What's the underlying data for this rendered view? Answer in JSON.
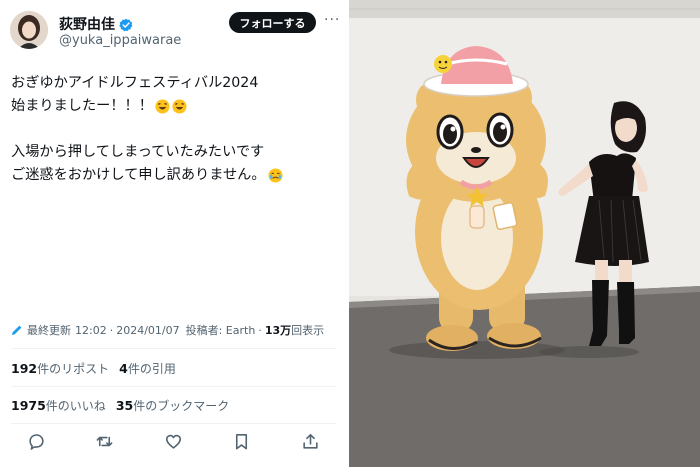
{
  "tweet": {
    "display_name": "荻野由佳",
    "handle": "@yuka_ippaiwarae",
    "verified": true,
    "follow_label": "フォローする",
    "more_label": "···",
    "lines": [
      "おぎゆかアイドルフェスティバル2024",
      "始まりましたー！！！",
      "",
      "入場から押してしまっていたみたいです",
      "ご迷惑をおかけして申し訳ありません。"
    ],
    "meta": {
      "edited_label": "最終更新",
      "time": "12:02",
      "sep1": "·",
      "date": "2024/01/07",
      "posted_label": "投稿者: Earth",
      "sep2": "·",
      "views": "13万",
      "views_label": "回表示"
    },
    "stats": {
      "reposts_count": "192",
      "reposts_label": "件のリポスト",
      "quotes_count": "4",
      "quotes_label": "件の引用",
      "likes_count": "1975",
      "likes_label": "件のいいね",
      "bookmarks_count": "35",
      "bookmarks_label": "件のブックマーク"
    },
    "actions": [
      "reply-icon",
      "repost-icon",
      "like-icon",
      "bookmark-icon",
      "share-icon"
    ]
  },
  "colors": {
    "text": "#0f1419",
    "secondary": "#536471",
    "verified": "#1d9bf0",
    "follow_bg": "#0f1419",
    "divider": "#eff3f4"
  }
}
